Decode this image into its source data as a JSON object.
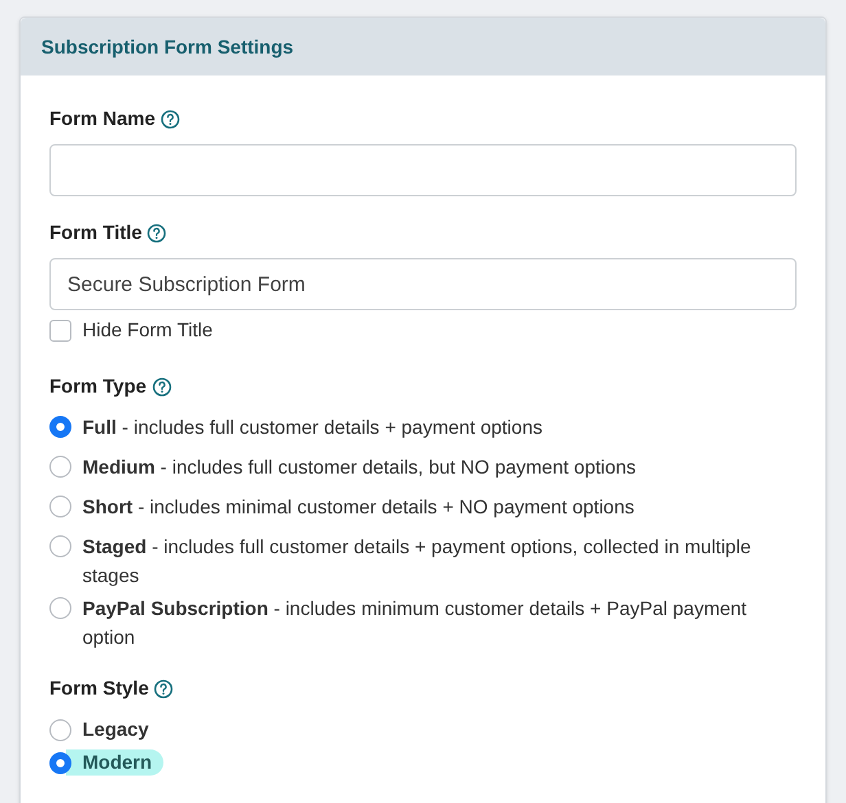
{
  "panel": {
    "title": "Subscription Form Settings"
  },
  "form_name": {
    "label": "Form Name"
  },
  "form_title": {
    "label": "Form Title",
    "value": "Secure Subscription Form",
    "hide_checkbox": {
      "label": "Hide Form Title",
      "checked": false
    }
  },
  "form_type": {
    "label": "Form Type",
    "options": [
      {
        "text": "**Full** - includes full customer details + payment options",
        "selected": true
      },
      {
        "text": "**Medium** - includes full customer details, but NO payment options",
        "selected": false
      },
      {
        "text": "**Short** - includes minimal customer details + NO payment options",
        "selected": false
      },
      {
        "text": "**Staged** - includes full customer details + payment options, collected in multiple stages",
        "selected": false
      },
      {
        "text": "**PayPal Subscription** - includes minimum customer details + PayPal payment option",
        "selected": false
      }
    ]
  },
  "form_style": {
    "label": "Form Style",
    "options": [
      {
        "text": "Legacy",
        "selected": false,
        "highlighted": false
      },
      {
        "text": "Modern",
        "selected": true,
        "highlighted": true
      }
    ]
  }
}
